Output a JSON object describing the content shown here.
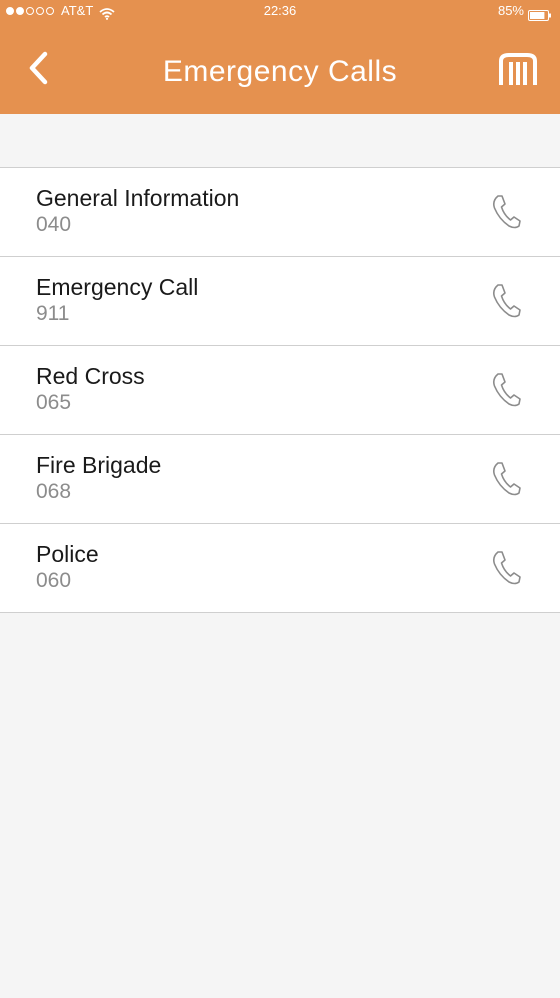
{
  "status_bar": {
    "carrier": "AT&T",
    "time": "22:36",
    "battery": "85%",
    "signal_bars_filled": 2,
    "signal_bars_total": 5,
    "battery_level": 0.85
  },
  "header": {
    "title": "Emergency Calls",
    "back_icon": "chevron-left-icon",
    "logo_icon": "metro-logo-icon"
  },
  "colors": {
    "header_bg": "#e5914f",
    "page_bg": "#f5f5f5",
    "text_primary": "#1a1a1a",
    "text_secondary": "#8c8c8c",
    "icon": "#8c8c8c"
  },
  "contacts": [
    {
      "name": "General Information",
      "number": "040",
      "icon": "phone-icon"
    },
    {
      "name": "Emergency Call",
      "number": "911",
      "icon": "phone-icon"
    },
    {
      "name": "Red Cross",
      "number": "065",
      "icon": "phone-icon"
    },
    {
      "name": "Fire Brigade",
      "number": "068",
      "icon": "phone-icon"
    },
    {
      "name": "Police",
      "number": "060",
      "icon": "phone-icon"
    }
  ]
}
